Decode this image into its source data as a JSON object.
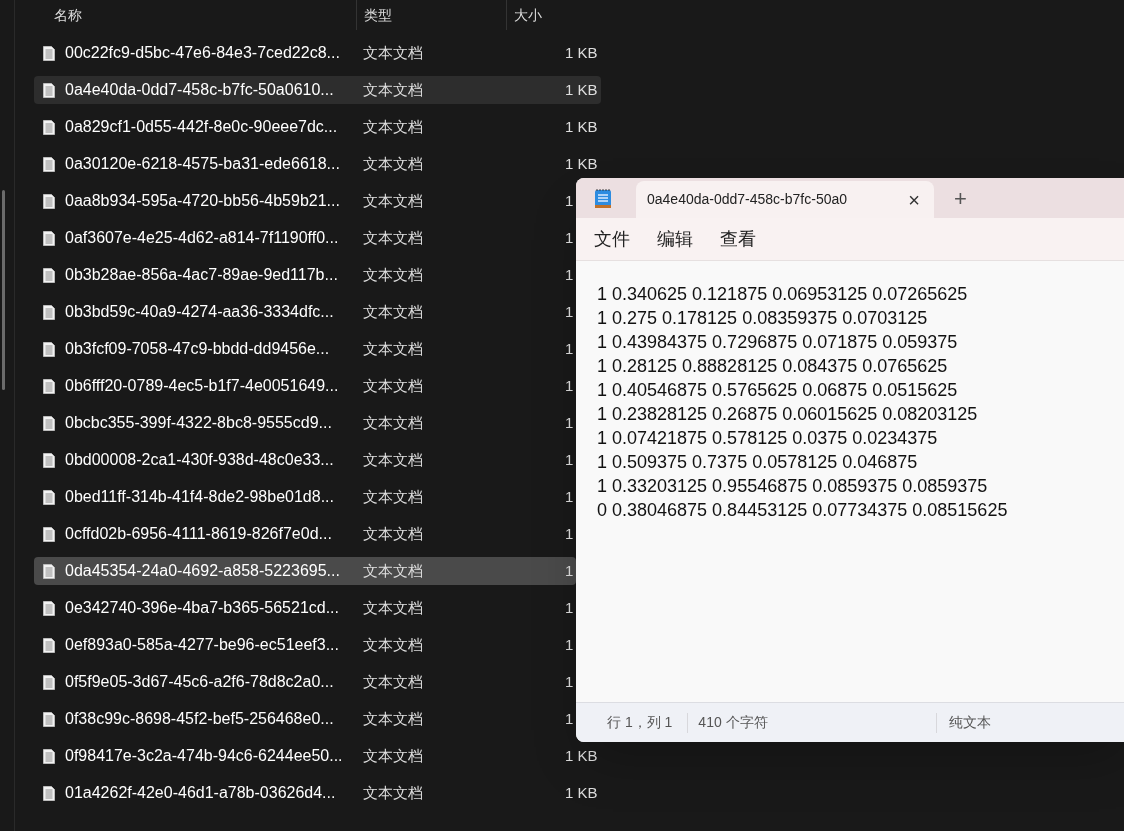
{
  "explorer": {
    "columns": [
      "名称",
      "类型",
      "大小"
    ],
    "rows": [
      {
        "name": "00c22fc9-d5bc-47e6-84e3-7ced22c8...",
        "type": "文本文档",
        "size": "1 KB",
        "selected": false,
        "hovered": false
      },
      {
        "name": "0a4e40da-0dd7-458c-b7fc-50a0610...",
        "type": "文本文档",
        "size": "1 KB",
        "selected": false,
        "hovered": true
      },
      {
        "name": "0a829cf1-0d55-442f-8e0c-90eee7dc...",
        "type": "文本文档",
        "size": "1 KB",
        "selected": false,
        "hovered": false
      },
      {
        "name": "0a30120e-6218-4575-ba31-ede6618...",
        "type": "文本文档",
        "size": "1 KB",
        "selected": false,
        "hovered": false
      },
      {
        "name": "0aa8b934-595a-4720-bb56-4b59b21...",
        "type": "文本文档",
        "size": "1",
        "selected": false,
        "hovered": false
      },
      {
        "name": "0af3607e-4e25-4d62-a814-7f1190ff0...",
        "type": "文本文档",
        "size": "1",
        "selected": false,
        "hovered": false
      },
      {
        "name": "0b3b28ae-856a-4ac7-89ae-9ed117b...",
        "type": "文本文档",
        "size": "1",
        "selected": false,
        "hovered": false
      },
      {
        "name": "0b3bd59c-40a9-4274-aa36-3334dfc...",
        "type": "文本文档",
        "size": "1",
        "selected": false,
        "hovered": false
      },
      {
        "name": "0b3fcf09-7058-47c9-bbdd-dd9456e...",
        "type": "文本文档",
        "size": "1",
        "selected": false,
        "hovered": false
      },
      {
        "name": "0b6fff20-0789-4ec5-b1f7-4e0051649...",
        "type": "文本文档",
        "size": "1",
        "selected": false,
        "hovered": false
      },
      {
        "name": "0bcbc355-399f-4322-8bc8-9555cd9...",
        "type": "文本文档",
        "size": "1",
        "selected": false,
        "hovered": false
      },
      {
        "name": "0bd00008-2ca1-430f-938d-48c0e33...",
        "type": "文本文档",
        "size": "1",
        "selected": false,
        "hovered": false
      },
      {
        "name": "0bed11ff-314b-41f4-8de2-98be01d8...",
        "type": "文本文档",
        "size": "1",
        "selected": false,
        "hovered": false
      },
      {
        "name": "0cffd02b-6956-4111-8619-826f7e0d...",
        "type": "文本文档",
        "size": "1",
        "selected": false,
        "hovered": false
      },
      {
        "name": "0da45354-24a0-4692-a858-5223695...",
        "type": "文本文档",
        "size": "1",
        "selected": true,
        "hovered": false
      },
      {
        "name": "0e342740-396e-4ba7-b365-56521cd...",
        "type": "文本文档",
        "size": "1",
        "selected": false,
        "hovered": false
      },
      {
        "name": "0ef893a0-585a-4277-be96-ec51eef3...",
        "type": "文本文档",
        "size": "1",
        "selected": false,
        "hovered": false
      },
      {
        "name": "0f5f9e05-3d67-45c6-a2f6-78d8c2a0...",
        "type": "文本文档",
        "size": "1",
        "selected": false,
        "hovered": false
      },
      {
        "name": "0f38c99c-8698-45f2-bef5-256468e0...",
        "type": "文本文档",
        "size": "1",
        "selected": false,
        "hovered": false
      },
      {
        "name": "0f98417e-3c2a-474b-94c6-6244ee50...",
        "type": "文本文档",
        "size": "1 KB",
        "selected": false,
        "hovered": false
      },
      {
        "name": "01a4262f-42e0-46d1-a78b-03626d4...",
        "type": "文本文档",
        "size": "1 KB",
        "selected": false,
        "hovered": false
      }
    ]
  },
  "notepad": {
    "tab": {
      "title": "0a4e40da-0dd7-458c-b7fc-50a0",
      "close": "×"
    },
    "new_tab": "+",
    "menu": [
      "文件",
      "编辑",
      "查看"
    ],
    "lines": [
      "1 0.340625 0.121875 0.06953125 0.07265625",
      "1 0.275 0.178125 0.08359375 0.0703125",
      "1 0.43984375 0.7296875 0.071875 0.059375",
      "1 0.28125 0.88828125 0.084375 0.0765625",
      "1 0.40546875 0.5765625 0.06875 0.0515625",
      "1 0.23828125 0.26875 0.06015625 0.08203125",
      "1 0.07421875 0.578125 0.0375 0.0234375",
      "1 0.509375 0.7375 0.0578125 0.046875",
      "1 0.33203125 0.95546875 0.0859375 0.0859375",
      "0 0.38046875 0.84453125 0.07734375 0.08515625"
    ],
    "status_bar": {
      "position": "行 1，列 1",
      "characters": "410 个字符",
      "encoding": "纯文本"
    }
  }
}
